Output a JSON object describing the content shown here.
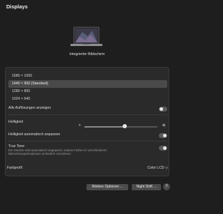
{
  "window": {
    "title": "Displays"
  },
  "display": {
    "name": "Integrierter Bildschirm",
    "icon": "laptop-icon"
  },
  "resolutions": {
    "items": [
      "1680 × 1050",
      "1440 × 900 (Standard)",
      "1280 × 800",
      "1024 × 640"
    ],
    "selected_index": 1,
    "show_all_label": "Alle Auflösungen anzeigen",
    "show_all_on": false
  },
  "brightness": {
    "label": "Helligkeit",
    "value": 0.55,
    "auto_label": "Helligkeit automatisch anpassen",
    "auto_on": true
  },
  "true_tone": {
    "label": "True Tone",
    "description": "Der Monitor wird automatisch angepasst, sodass Farben in verschiedenen Beleuchtungssituationen einheitlich erscheinen.",
    "on": true
  },
  "color_profile": {
    "label": "Farbprofil",
    "value": "Color LCD ◇"
  },
  "buttons": {
    "advanced": "Weitere Optionen ...",
    "night_shift": "Night Shift ...",
    "help": "?"
  },
  "colors": {
    "background": "#1e1e1e",
    "panel": "#2a2a2a",
    "selected_row": "#4a4a4a",
    "button": "#4b4b4b"
  }
}
